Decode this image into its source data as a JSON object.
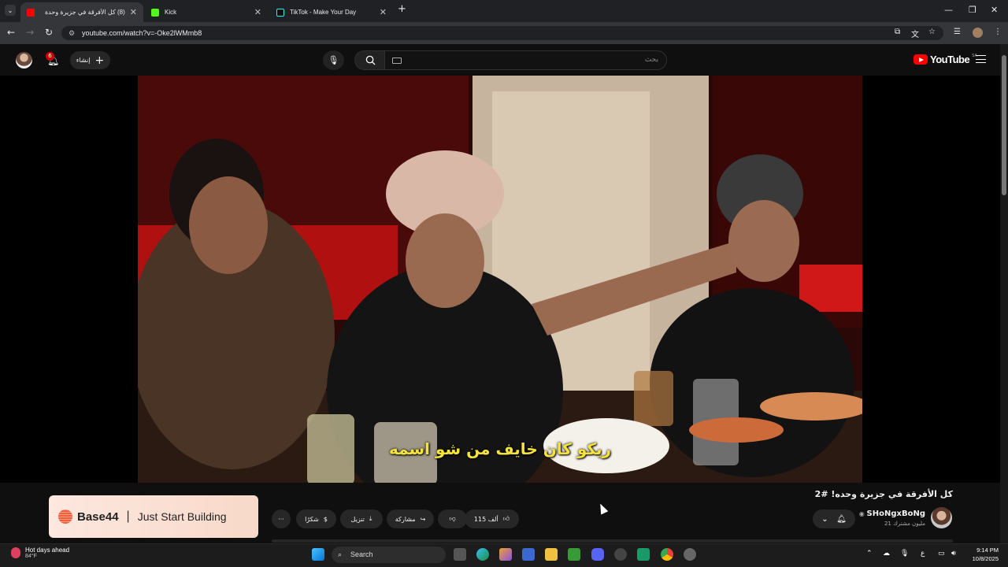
{
  "browser": {
    "tabs": [
      {
        "title": "(8) كل الأفرقة في جزيرة وحدة",
        "active": true
      },
      {
        "title": "Kick",
        "active": false
      },
      {
        "title": "TikTok - Make Your Day",
        "active": false
      }
    ],
    "new_tab_glyph": "+",
    "url": "youtube.com/watch?v=-Oke2lWMmb8",
    "window_controls": {
      "minimize": "—",
      "maximize": "❐",
      "close": "✕"
    }
  },
  "youtube": {
    "logo_text": "YouTube",
    "country_code": "SA",
    "search_placeholder": "بحث",
    "create_label": "إنشاء",
    "notification_count": "6",
    "video": {
      "subtitle": "ريكو كان خايف من شو اسمه",
      "title": "كل الأفرقة في جزيرة وحده! #2",
      "channel": "SHoNgxBoNg",
      "subscribers": "21 مليون مشترك",
      "likes_label": "115 ألف",
      "share_label": "مشاركة",
      "download_label": "تنزيل",
      "thanks_label": "شكرًا",
      "more_label": "···"
    },
    "ad": {
      "brand": "Base44",
      "separator": "|",
      "tagline": "Just Start Building"
    }
  },
  "taskbar": {
    "weather_title": "Hot days ahead",
    "weather_temp": "84°F",
    "search_label": "Search",
    "time": "9:14 PM",
    "date": "10/8/2025",
    "lang": "ع"
  },
  "colors": {
    "yt_red": "#ff0000",
    "subtitle_yellow": "#f5e23a",
    "bg": "#0f0f0f"
  }
}
